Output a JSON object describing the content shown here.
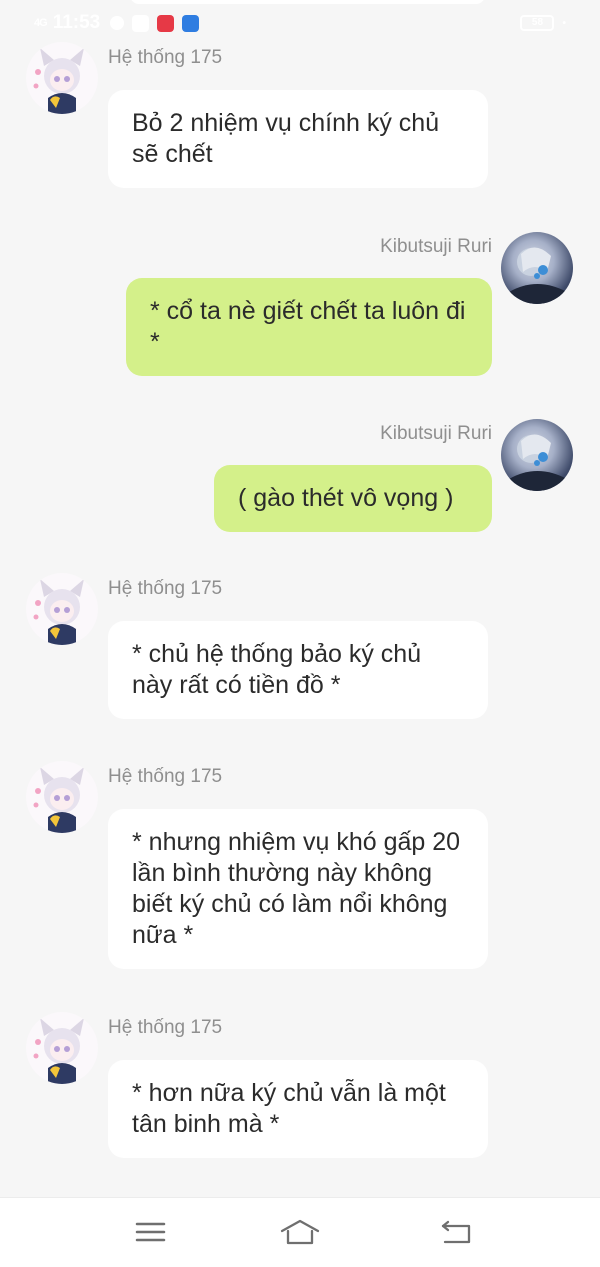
{
  "status_bar": {
    "signal": "4G",
    "time": "11:53",
    "battery": "58",
    "icons": [
      "message-icon",
      "facebook-icon",
      "mangatoon-icon",
      "noveltoon-icon"
    ]
  },
  "messages": [
    {
      "side": "left",
      "sender": "Hệ thống 175",
      "text": "Bỏ 2 nhiệm vụ chính ký chủ sẽ chết"
    },
    {
      "side": "right",
      "sender": "Kibutsuji Ruri",
      "text": "* cổ ta nè giết chết ta luôn đi *"
    },
    {
      "side": "right",
      "sender": "Kibutsuji Ruri",
      "text": "( gào thét vô vọng )"
    },
    {
      "side": "left",
      "sender": "Hệ thống 175",
      "text": "* chủ hệ thống bảo ký chủ này rất có tiền đồ *"
    },
    {
      "side": "left",
      "sender": "Hệ thống 175",
      "text": "* nhưng nhiệm vụ khó gấp 20 lần bình thường này không biết ký chủ có làm nổi không nữa *"
    },
    {
      "side": "left",
      "sender": "Hệ thống 175",
      "text": "* hơn nữa ký chủ vẫn là một tân binh mà *"
    }
  ],
  "nav": {
    "buttons": [
      "menu",
      "home",
      "back"
    ]
  },
  "colors": {
    "background": "#f6f6f6",
    "bubble_left": "#ffffff",
    "bubble_right": "#d4f08a",
    "sender_text": "#8f8f8f"
  }
}
